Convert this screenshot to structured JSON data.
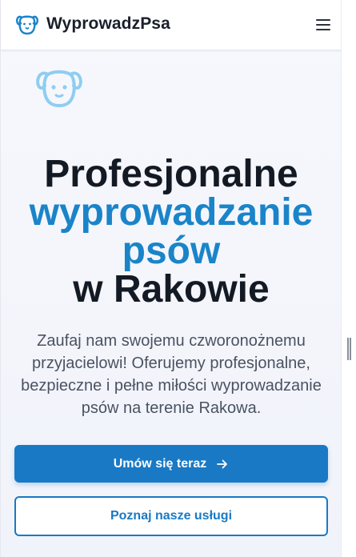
{
  "header": {
    "brand": "WyprowadzPsa",
    "logo_icon": "dog-face-icon",
    "menu_icon": "hamburger-menu-icon"
  },
  "hero": {
    "icon": "dog-face-icon",
    "headline_line1": "Profesjonalne",
    "headline_accent1": "wyprowadzanie",
    "headline_accent2": "psów",
    "headline_line2": "w Rakowie",
    "subtext": "Zaufaj nam swojemu czworonożnemu przyjacielowi! Oferujemy profesjonalne, bezpieczne i pełne miłości wyprowadzanie psów na terenie Rakowa.",
    "primary_button": "Umów się teraz",
    "primary_button_icon": "arrow-right-icon",
    "secondary_button": "Poznaj nasze usługi"
  },
  "colors": {
    "accent": "#1a84c9",
    "button": "#1979c4",
    "text_dark": "#141a24",
    "text_muted": "#4a5262"
  }
}
